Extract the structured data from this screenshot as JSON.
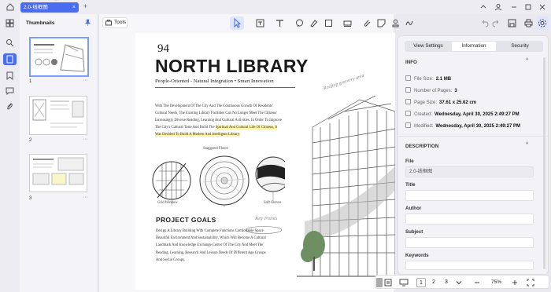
{
  "tab": {
    "title": "2.0-线框图",
    "close": "×"
  },
  "new_tab": "+",
  "thumbnails": {
    "title": "Thumbnails",
    "pages": [
      {
        "num": "1",
        "selected": true
      },
      {
        "num": "2",
        "selected": false
      },
      {
        "num": "3",
        "selected": false
      }
    ],
    "more": "···"
  },
  "toolbar": {
    "tools_label": "Tools"
  },
  "document": {
    "page_number": "94",
    "title": "NORTH LIBRARY",
    "subtitle": "People-Oriented - Natural Integration • Smart Innovation",
    "body_lines": [
      "With The Development Of The City And The Continuous Growth Of Residents'",
      "Cultural Needs, The Existing Library Facilities Can No Longer Meet The Citizens'",
      "Increasingly Diverse Reading, Learning And Cultural Activities. In Order To Improve",
      "The City's Cultural Taste And Build The",
      "Spiritual And Cultural Life Of Citizens, It",
      "Was Decided To Build A Modern And Intelligent Library."
    ],
    "captions": {
      "grid_window": "Grid Window",
      "staggered_floors": "Staggered Floors",
      "soft_curves": "Soft Curves",
      "rooftop": "Rooftop greenery area",
      "key_points": "Key Points"
    },
    "goals_title": "PROJECT GOALS",
    "goals_lines": [
      "Design A Library Building With Complete Functions Comfortable Space",
      "Beautiful Environment And Sustainability, Which Will Become A Cultural",
      "Landmark And Knowledge Exchange Center Of The City And Meet The",
      "Reading, Learning, Research And Leisure Needs Of Different Age Groups",
      "And Social Groups."
    ]
  },
  "bottombar": {
    "pages": [
      "1",
      "2",
      "3"
    ],
    "current": "1",
    "zoom": "75%"
  },
  "panel": {
    "tabs": [
      "View Settings",
      "Information",
      "Security"
    ],
    "active_tab": "Information",
    "info_title": "INFO",
    "info": [
      {
        "label": "File Size:",
        "value": "2.1 MB"
      },
      {
        "label": "Number of Pages:",
        "value": "3"
      },
      {
        "label": "Page Size:",
        "value": "37.61 x 25.62 cm"
      },
      {
        "label": "Created:",
        "value": "Wednesday, April 30, 2025 2:49:27 PM"
      },
      {
        "label": "Modified:",
        "value": "Wednesday, April 30, 2025 2:49:27 PM"
      }
    ],
    "desc_title": "DESCRIPTION",
    "fields": [
      {
        "label": "File",
        "value": "2.0-线框图"
      },
      {
        "label": "Title",
        "value": ""
      },
      {
        "label": "Author",
        "value": ""
      },
      {
        "label": "Subject",
        "value": ""
      },
      {
        "label": "Keywords",
        "value": ""
      }
    ]
  },
  "colors": {
    "accent": "#4a6cf0",
    "highlight": "#fff3a0",
    "panel_bg": "#f3f3f7"
  }
}
